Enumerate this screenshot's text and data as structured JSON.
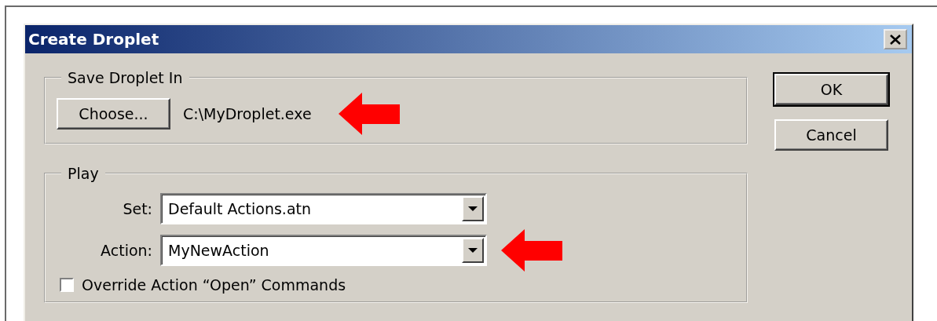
{
  "window": {
    "title": "Create Droplet"
  },
  "save_group": {
    "legend": "Save Droplet In",
    "choose_button": "Choose...",
    "path": "C:\\MyDroplet.exe"
  },
  "play_group": {
    "legend": "Play",
    "fields": [
      {
        "label": "Set:",
        "value": "Default Actions.atn"
      },
      {
        "label": "Action:",
        "value": "MyNewAction"
      }
    ],
    "checkbox": {
      "label": "Override Action “Open” Commands",
      "checked": false
    }
  },
  "buttons": [
    {
      "label": "OK",
      "default": true
    },
    {
      "label": "Cancel",
      "default": false
    }
  ]
}
